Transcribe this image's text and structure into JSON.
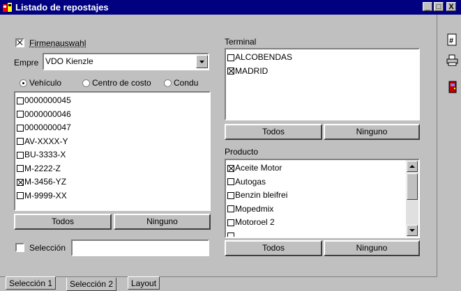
{
  "window": {
    "title": "Listado de repostajes",
    "minimize": "_",
    "maximize": "□",
    "close": "X"
  },
  "left": {
    "company_filter": {
      "label": "Firmenauswahl",
      "checked": true
    },
    "company": {
      "label": "Empre",
      "value": "VDO Kienzle"
    },
    "mode": {
      "options": [
        {
          "label": "Vehículo",
          "selected": true
        },
        {
          "label": "Centro de costo",
          "selected": false
        },
        {
          "label": "Condu",
          "selected": false
        }
      ]
    },
    "vehicles": [
      {
        "label": "0000000045",
        "checked": false
      },
      {
        "label": "0000000046",
        "checked": false
      },
      {
        "label": "0000000047",
        "checked": false
      },
      {
        "label": "AV-XXXX-Y",
        "checked": false
      },
      {
        "label": "BU-3333-X",
        "checked": false
      },
      {
        "label": "M-2222-Z",
        "checked": false
      },
      {
        "label": "M-3456-YZ",
        "checked": true
      },
      {
        "label": "M-9999-XX",
        "checked": false
      }
    ],
    "all_button": "Todos",
    "none_button": "Ninguno",
    "selection": {
      "label": "Selección",
      "checked": false,
      "value": ""
    }
  },
  "terminal": {
    "label": "Terminal",
    "items": [
      {
        "label": "ALCOBENDAS",
        "checked": false
      },
      {
        "label": "MADRID",
        "checked": true
      }
    ],
    "all_button": "Todos",
    "none_button": "Ninguno"
  },
  "product": {
    "label": "Producto",
    "items": [
      {
        "label": "Aceite Motor",
        "checked": true
      },
      {
        "label": "Autogas",
        "checked": false
      },
      {
        "label": "Benzin bleifrei",
        "checked": false
      },
      {
        "label": "Mopedmix",
        "checked": false
      },
      {
        "label": "Motoroel 2",
        "checked": false
      }
    ],
    "all_button": "Todos",
    "none_button": "Ninguno"
  },
  "tabs": [
    {
      "label": "Selección 1",
      "active": false
    },
    {
      "label": "Selección 2",
      "active": true
    },
    {
      "label": "Layout",
      "active": false
    }
  ],
  "toolbar": {
    "calculator_icon": "calculator-icon",
    "printer_icon": "printer-icon",
    "exit_icon": "exit-door-icon"
  }
}
